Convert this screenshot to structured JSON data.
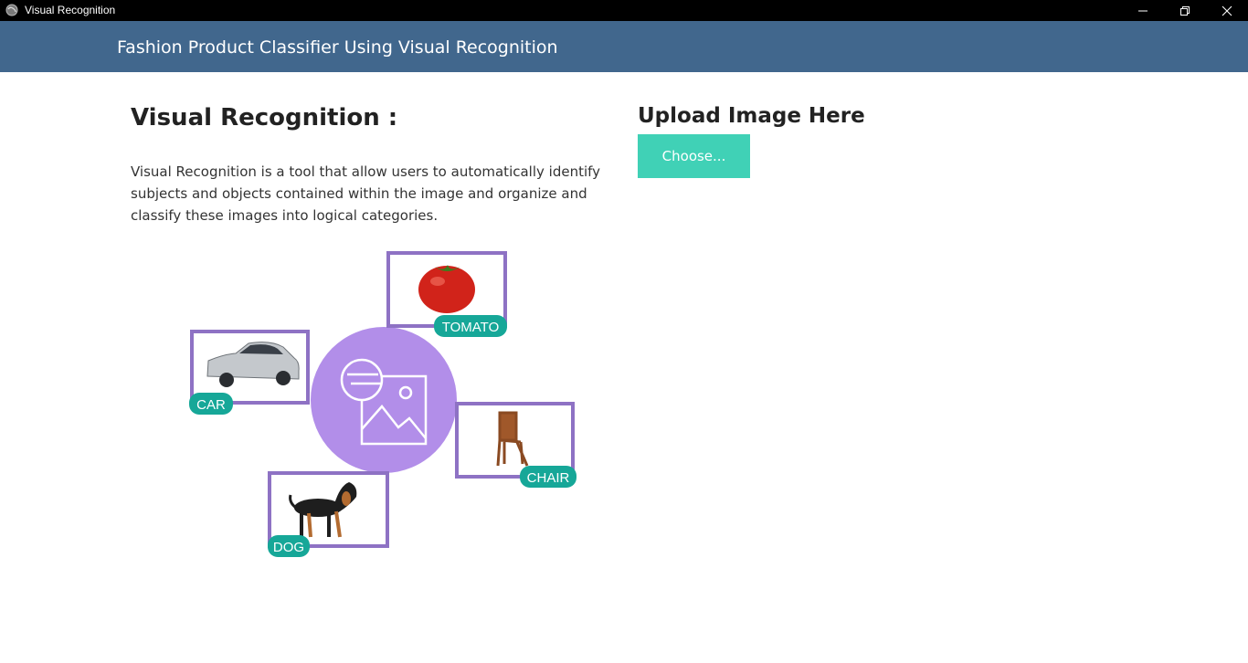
{
  "window": {
    "title": "Visual Recognition",
    "controls": [
      "minimize-icon",
      "restore-icon",
      "close-icon"
    ]
  },
  "header": {
    "title": "Fashion Product Classifier Using Visual Recognition"
  },
  "main": {
    "heading": "Visual Recognition :",
    "description": "Visual Recognition is a tool that allow users to automatically identify subjects and objects contained within the image and organize and classify these images into logical categories."
  },
  "upload": {
    "heading": "Upload Image Here",
    "button_label": "Choose..."
  },
  "illustration": {
    "labels": {
      "tomato": "TOMATO",
      "car": "CAR",
      "chair": "CHAIR",
      "dog": "DOG"
    }
  },
  "colors": {
    "titlebar": "#000000",
    "header": "#41678d",
    "choose_button": "#40d1b6",
    "illustration_frame": "#8e72c4",
    "illustration_circle": "#b28ee9",
    "illustration_label": "#16a798"
  }
}
